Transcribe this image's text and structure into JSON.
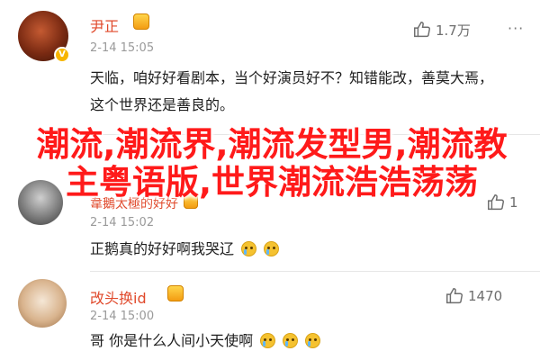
{
  "comments": [
    {
      "username": "尹正",
      "timestamp": "2-14 15:05",
      "likes": "1.7万",
      "more": "···",
      "text": "天临，咱好好看剧本，当个好演员好不？知错能改，善莫大焉，这个世界还是善良的。"
    },
    {
      "username": "韋鵝太極的好好",
      "timestamp": "2-14 15:02",
      "likes": "1",
      "text": "正鹅真的好好啊我哭辽"
    },
    {
      "username": "改头换id",
      "timestamp": "2-14 15:00",
      "likes": "1470",
      "text": "哥 你是什么人间小天使啊"
    }
  ],
  "overlay_text": "潮流,潮流界,潮流发型男,潮流教主粤语版,世界潮流浩浩荡荡",
  "colors": {
    "username": "#e0492b",
    "overlay": "#ff1a1a",
    "badge": "#f7b500"
  },
  "icons": {
    "like": "thumbs-up-icon",
    "verified": "verified-v-icon",
    "more": "more-dots-icon"
  }
}
